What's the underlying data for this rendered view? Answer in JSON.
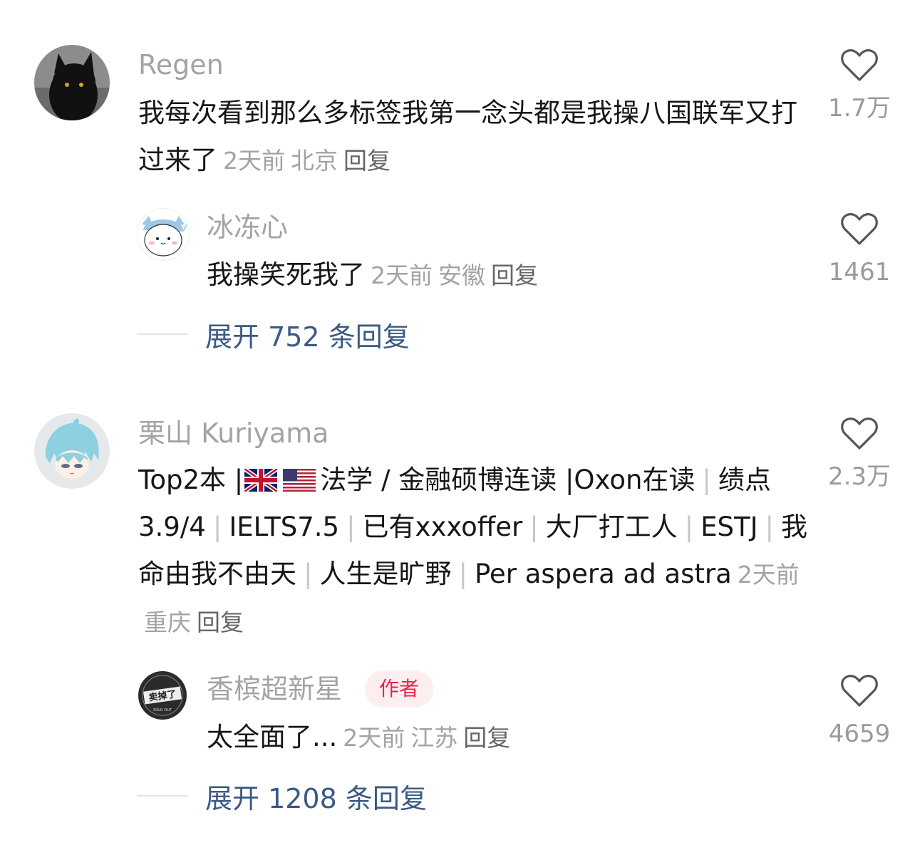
{
  "comments": [
    {
      "username": "Regen",
      "text": "我每次看到那么多标签我第一念头都是我操八国联军又打过来了",
      "time": "2天前",
      "location": "北京",
      "reply_label": "回复",
      "likes": "1.7万",
      "avatar": "black-cat-avatar",
      "replies": [
        {
          "username": "冰冻心",
          "text": "我操笑死我了",
          "time": "2天前",
          "location": "安徽",
          "reply_label": "回复",
          "likes": "1461",
          "avatar": "chiikawa-avatar"
        }
      ],
      "expand_label": "展开 752 条回复"
    },
    {
      "username": "栗山 Kuriyama",
      "text_parts": {
        "p1": "Top2本 |",
        "p2": "法学 / 金融硕博连读 |Oxon在读",
        "p3": "绩点3.9/4",
        "p4": "IELTS7.5",
        "p5": "已有xxxoffer",
        "p6": "大厂打工人",
        "p7": "ESTJ",
        "p8": "我命由我不由天",
        "p9": "人生是旷野",
        "p10": "Per aspera ad astra"
      },
      "flags": [
        "uk-flag-icon",
        "us-flag-icon"
      ],
      "time": "2天前",
      "location": "重庆",
      "reply_label": "回复",
      "likes": "2.3万",
      "avatar": "anime-boy-avatar",
      "replies": [
        {
          "username": "香槟超新星",
          "badge": "作者",
          "text": "太全面了...",
          "time": "2天前",
          "location": "江苏",
          "reply_label": "回复",
          "likes": "4659",
          "avatar": "sold-out-sticker-avatar"
        }
      ],
      "expand_label": "展开 1208 条回复"
    }
  ],
  "colors": {
    "username": "#a3a3a3",
    "meta": "#a3a3a3",
    "body": "#161616",
    "expand_link": "#3b5a83",
    "author_badge_text": "#f0204a",
    "author_badge_bg": "#fdeef0"
  }
}
